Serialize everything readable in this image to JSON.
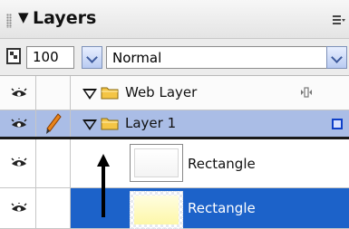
{
  "panel": {
    "title": "Layers",
    "options_icon": "panel-options-icon",
    "collapse_icon": "collapse-triangle-icon"
  },
  "controls": {
    "opacity_value": "100",
    "blend_mode": "Normal"
  },
  "layers": [
    {
      "label": "Web Layer",
      "type": "folder",
      "expanded": true,
      "icons": [
        "eye-icon",
        "web-layer-icon"
      ]
    },
    {
      "label": "Layer 1",
      "type": "folder",
      "expanded": true,
      "active": true,
      "icons": [
        "eye-icon",
        "pencil-icon",
        "layer-color-swatch"
      ]
    },
    {
      "label": "Rectangle",
      "type": "object",
      "thumbnail": "white",
      "selected": false
    },
    {
      "label": "Rectangle",
      "type": "object",
      "thumbnail": "yellow",
      "selected": true
    }
  ],
  "colors": {
    "selection_blue": "#1c62c9",
    "active_layer_row": "#aabde6",
    "layer_swatch": "#1040c8",
    "folder_yellow": "#f4c545"
  }
}
